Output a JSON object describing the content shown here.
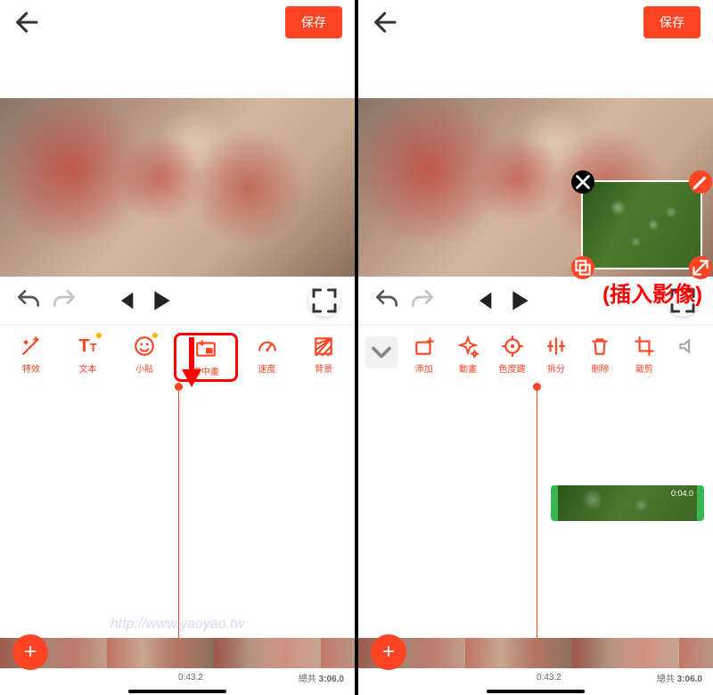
{
  "header": {
    "save_label": "保存"
  },
  "annotation": {
    "insert_image": "(插入影像)"
  },
  "toolbar_a": [
    {
      "name": "effects",
      "label": "特效"
    },
    {
      "name": "text",
      "label": "文本"
    },
    {
      "name": "sticker",
      "label": "小貼"
    },
    {
      "name": "pip",
      "label": "畫中畫"
    },
    {
      "name": "speed",
      "label": "速度"
    },
    {
      "name": "background",
      "label": "背景"
    }
  ],
  "toolbar_b": [
    {
      "name": "add",
      "label": "添加"
    },
    {
      "name": "animation",
      "label": "動畫"
    },
    {
      "name": "chroma",
      "label": "色度鍵"
    },
    {
      "name": "split",
      "label": "拆分"
    },
    {
      "name": "delete",
      "label": "刪除"
    },
    {
      "name": "crop",
      "label": "裁剪"
    },
    {
      "name": "volume",
      "label": ""
    }
  ],
  "clip": {
    "duration": "0:04.0"
  },
  "time": {
    "current": "0:43.2",
    "total_label": "總共",
    "total": "3:06.0"
  },
  "watermark": "http://www.yaoyao.tw"
}
